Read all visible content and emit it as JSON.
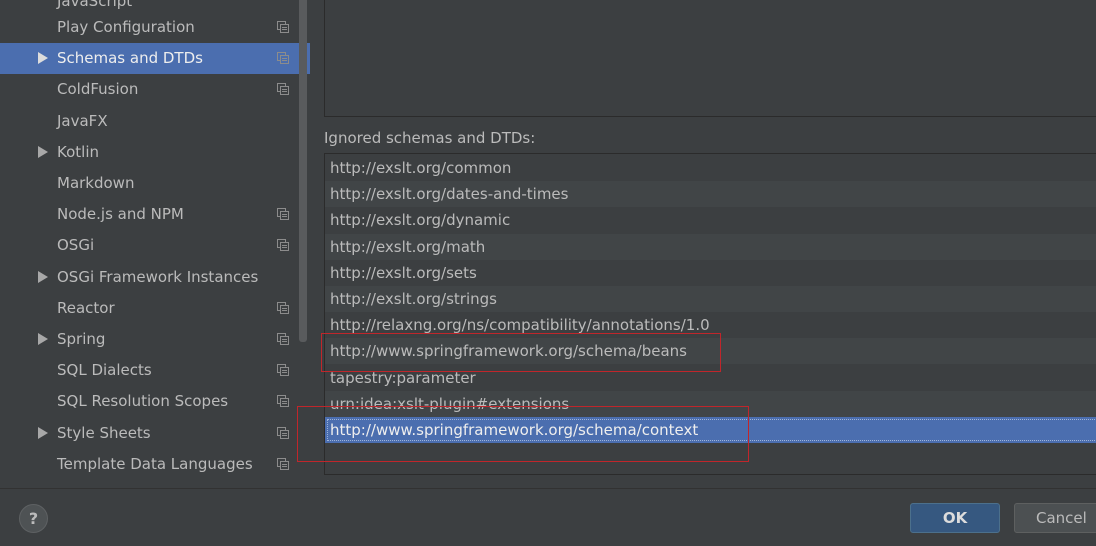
{
  "sidebar": {
    "partial_top_label": "JavaScript",
    "items": [
      {
        "label": "Play Configuration",
        "expandable": false,
        "copy_icon": true,
        "selected": false
      },
      {
        "label": "Schemas and DTDs",
        "expandable": true,
        "copy_icon": true,
        "selected": true
      },
      {
        "label": "ColdFusion",
        "expandable": false,
        "copy_icon": true,
        "selected": false
      },
      {
        "label": "JavaFX",
        "expandable": false,
        "copy_icon": false,
        "selected": false
      },
      {
        "label": "Kotlin",
        "expandable": true,
        "copy_icon": false,
        "selected": false
      },
      {
        "label": "Markdown",
        "expandable": false,
        "copy_icon": false,
        "selected": false
      },
      {
        "label": "Node.js and NPM",
        "expandable": false,
        "copy_icon": true,
        "selected": false
      },
      {
        "label": "OSGi",
        "expandable": false,
        "copy_icon": true,
        "selected": false
      },
      {
        "label": "OSGi Framework Instances",
        "expandable": true,
        "copy_icon": false,
        "selected": false
      },
      {
        "label": "Reactor",
        "expandable": false,
        "copy_icon": true,
        "selected": false
      },
      {
        "label": "Spring",
        "expandable": true,
        "copy_icon": true,
        "selected": false
      },
      {
        "label": "SQL Dialects",
        "expandable": false,
        "copy_icon": true,
        "selected": false
      },
      {
        "label": "SQL Resolution Scopes",
        "expandable": false,
        "copy_icon": true,
        "selected": false
      },
      {
        "label": "Style Sheets",
        "expandable": true,
        "copy_icon": true,
        "selected": false
      },
      {
        "label": "Template Data Languages",
        "expandable": false,
        "copy_icon": true,
        "selected": false
      }
    ]
  },
  "ignored": {
    "label": "Ignored schemas and DTDs:",
    "items": [
      {
        "text": "http://exslt.org/common",
        "selected": false
      },
      {
        "text": "http://exslt.org/dates-and-times",
        "selected": false
      },
      {
        "text": "http://exslt.org/dynamic",
        "selected": false
      },
      {
        "text": "http://exslt.org/math",
        "selected": false
      },
      {
        "text": "http://exslt.org/sets",
        "selected": false
      },
      {
        "text": "http://exslt.org/strings",
        "selected": false
      },
      {
        "text": "http://relaxng.org/ns/compatibility/annotations/1.0",
        "selected": false
      },
      {
        "text": "http://www.springframework.org/schema/beans",
        "selected": false,
        "highlighted": true
      },
      {
        "text": "tapestry:parameter",
        "selected": false
      },
      {
        "text": "urn:idea:xslt-plugin#extensions",
        "selected": false
      },
      {
        "text": "http://www.springframework.org/schema/context",
        "selected": true,
        "highlighted": true
      }
    ]
  },
  "footer": {
    "help_label": "?",
    "ok_label": "OK",
    "cancel_label": "Cancel"
  },
  "colors": {
    "background": "#3c3f41",
    "selection": "#4b6eaf",
    "highlight_border": "#c0262b",
    "ok_button": "#365880"
  }
}
